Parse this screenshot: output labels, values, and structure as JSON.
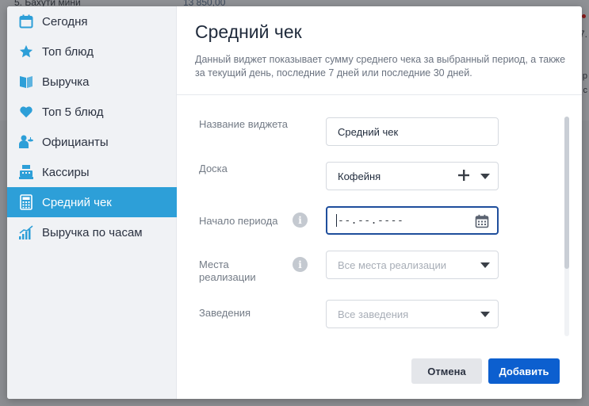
{
  "background": {
    "top_item": "5. Бахути мини",
    "top_value": "13 850,00",
    "right_fragment_1": "7.",
    "right_fragment_2": "р",
    "right_fragment_3": "с"
  },
  "sidebar": {
    "items": [
      {
        "label": "Сегодня",
        "icon": "calendar-icon",
        "active": false
      },
      {
        "label": "Топ блюд",
        "icon": "star-icon",
        "active": false
      },
      {
        "label": "Выручка",
        "icon": "book-icon",
        "active": false
      },
      {
        "label": "Топ 5 блюд",
        "icon": "heart-icon",
        "active": false
      },
      {
        "label": "Официанты",
        "icon": "waiter-icon",
        "active": false
      },
      {
        "label": "Кассиры",
        "icon": "cash-register-icon",
        "active": false
      },
      {
        "label": "Средний чек",
        "icon": "calculator-icon",
        "active": true
      },
      {
        "label": "Выручка по часам",
        "icon": "bar-chart-icon",
        "active": false
      }
    ]
  },
  "header": {
    "title": "Средний чек",
    "description": "Данный виджет показывает сумму среднего чека за выбранный период, а также за текущий день, последние 7 дней или последние 30 дней."
  },
  "form": {
    "name_label": "Название виджета",
    "name_value": "Средний чек",
    "board_label": "Доска",
    "board_value": "Кофейня",
    "period_label": "Начало периода",
    "period_mask": "--.--.----",
    "places_label_1": "Места",
    "places_label_2": "реализации",
    "places_placeholder": "Все места реализации",
    "venues_label": "Заведения",
    "venues_placeholder": "Все заведения"
  },
  "buttons": {
    "cancel": "Отмена",
    "add": "Добавить"
  },
  "colors": {
    "accent": "#2d9fd8",
    "primary_button": "#0c5fcf",
    "focus_border": "#1f4e9c"
  }
}
